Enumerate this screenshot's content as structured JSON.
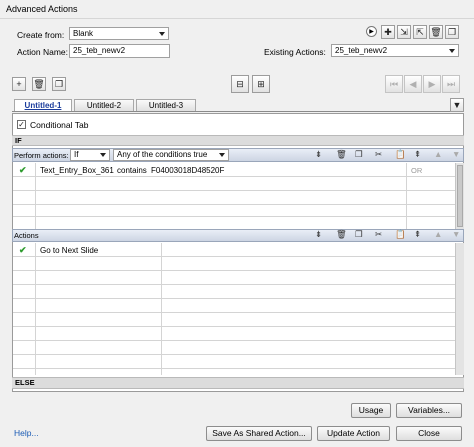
{
  "window": {
    "title": "Advanced Actions"
  },
  "form": {
    "create_from_label": "Create from:",
    "create_from_value": "Blank",
    "action_name_label": "Action Name:",
    "action_name_value": "25_teb_newv2",
    "existing_actions_label": "Existing Actions:",
    "existing_actions_value": "25_teb_newv2"
  },
  "tabs": [
    {
      "label": "Untitled-1",
      "active": true
    },
    {
      "label": "Untitled-2",
      "active": false
    },
    {
      "label": "Untitled-3",
      "active": false
    }
  ],
  "conditional_tab": {
    "label": "Conditional Tab",
    "checked": true
  },
  "if_section": {
    "label": "IF",
    "perform_actions_label": "Perform actions:",
    "perform_actions_value": "If",
    "condition_value": "Any of the conditions true",
    "rows": [
      {
        "var": "Text_Entry_Box_361",
        "op": "contains",
        "value": "F04003018D48520F",
        "logic": "OR",
        "status": "ok"
      }
    ]
  },
  "actions_section": {
    "label": "Actions",
    "rows": [
      {
        "action": "Go to Next Slide",
        "status": "ok"
      }
    ]
  },
  "else_section": {
    "label": "ELSE"
  },
  "buttons": {
    "usage": "Usage",
    "variables": "Variables...",
    "help": "Help...",
    "save_shared": "Save As Shared Action...",
    "update": "Update Action",
    "close": "Close"
  },
  "icons": {
    "toolbar_top": [
      "play-icon",
      "add-icon",
      "import-icon",
      "export-icon",
      "delete-icon",
      "duplicate-icon"
    ],
    "toolbar_left": [
      "add-icon",
      "delete-icon",
      "copy-icon"
    ],
    "section_tools": [
      "insert-above-icon",
      "delete-icon",
      "copy-icon",
      "cut-icon",
      "paste-icon",
      "insert-below-icon",
      "move-up-icon",
      "move-down-icon"
    ],
    "check": "check-icon"
  }
}
